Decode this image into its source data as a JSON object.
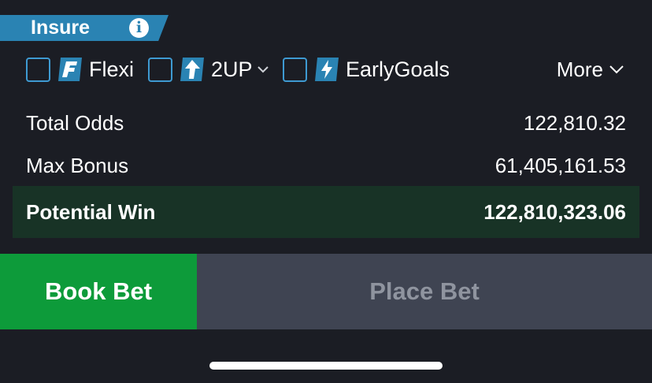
{
  "insure": {
    "label": "Insure",
    "info_icon": "info-icon"
  },
  "options": [
    {
      "label": "Flexi",
      "icon": "flexi-icon",
      "checked": false,
      "has_dropdown": false
    },
    {
      "label": "2UP",
      "icon": "up-arrow-icon",
      "checked": false,
      "has_dropdown": true
    },
    {
      "label": "EarlyGoals",
      "icon": "lightning-icon",
      "checked": false,
      "has_dropdown": false
    }
  ],
  "more": {
    "label": "More"
  },
  "summary": {
    "total_odds_label": "Total Odds",
    "total_odds_value": "122,810.32",
    "max_bonus_label": "Max Bonus",
    "max_bonus_value": "61,405,161.53",
    "potential_win_label": "Potential Win",
    "potential_win_value": "122,810,323.06"
  },
  "actions": {
    "book_bet": "Book Bet",
    "place_bet": "Place Bet"
  },
  "colors": {
    "background": "#1b1d24",
    "accent_blue": "#2a83b3",
    "win_row": "#183326",
    "book_green": "#0d9b3a",
    "place_disabled": "#3f4452"
  }
}
